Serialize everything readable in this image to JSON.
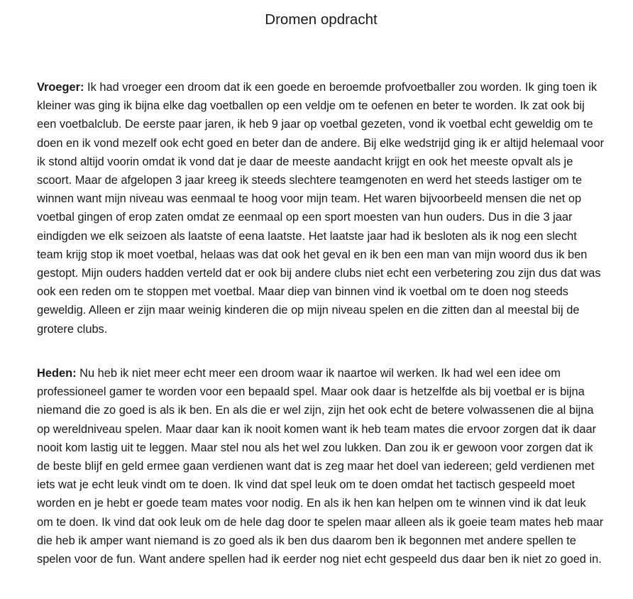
{
  "document": {
    "title": "Dromen opdracht",
    "sections": [
      {
        "label": "Vroeger:",
        "text": " Ik had vroeger een droom dat ik een goede en beroemde profvoetballer zou worden. Ik ging toen ik kleiner was ging ik bijna elke dag voetballen op een veldje om te oefenen en beter te worden. Ik zat ook bij een voetbalclub. De eerste paar jaren, ik heb 9 jaar op voetbal gezeten, vond ik voetbal echt geweldig om te doen en ik vond mezelf ook echt goed en beter dan de andere. Bij elke wedstrijd ging ik er altijd helemaal voor ik stond altijd voorin omdat ik vond dat je daar de meeste aandacht krijgt en ook het meeste opvalt als je scoort. Maar de afgelopen 3 jaar kreeg ik steeds slechtere teamgenoten en werd het steeds lastiger om te winnen want mijn niveau was eenmaal te hoog voor mijn team. Het waren bijvoorbeeld mensen die net op voetbal gingen of erop zaten omdat ze eenmaal op een sport moesten van hun ouders. Dus in die 3 jaar eindigden we elk seizoen als laatste of eena laatste. Het laatste jaar had ik besloten als ik nog een slecht team krijg stop ik moet voetbal, helaas was dat ook het geval en ik ben een man van mijn woord dus ik ben gestopt. Mijn ouders hadden verteld dat er ook bij andere clubs niet echt een verbetering zou zijn dus dat was ook een reden om te stoppen met voetbal. Maar diep van binnen vind ik voetbal om te doen nog steeds geweldig. Alleen er zijn maar weinig kinderen die op mijn niveau spelen en die zitten dan al meestal bij de grotere clubs."
      },
      {
        "label": "Heden:",
        "text": " Nu heb ik niet meer echt meer een droom waar ik naartoe wil werken. Ik had wel een idee om professioneel gamer te worden voor een bepaald spel. Maar ook daar is hetzelfde als bij voetbal er is bijna niemand die zo goed is als ik ben. En als die er wel zijn, zijn het ook echt de betere volwassenen die al bijna op wereldniveau spelen. Maar daar kan ik nooit komen want ik heb team mates die ervoor zorgen dat ik daar nooit kom lastig uit te leggen. Maar stel nou als het wel zou lukken. Dan zou ik er gewoon voor zorgen dat ik de beste blijf en geld ermee gaan verdienen want dat is zeg maar het doel van iedereen; geld verdienen met iets wat je echt leuk vindt om te doen. Ik vind dat spel leuk om te doen omdat het tactisch gespeeld moet worden en je hebt er goede team mates voor nodig. En als ik hen kan helpen om te winnen vind ik dat leuk om te doen. Ik vind dat ook leuk om de hele dag door te spelen maar alleen als ik goeie team mates heb maar die heb ik amper want niemand is zo goed als ik ben dus daarom ben ik begonnen met andere spellen te spelen voor de fun. Want andere spellen had ik eerder nog niet echt gespeeld dus daar ben ik niet zo goed in."
      }
    ]
  }
}
